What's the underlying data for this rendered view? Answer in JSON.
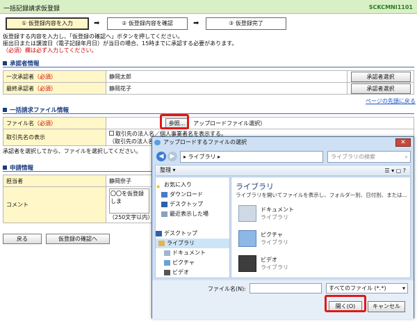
{
  "header": {
    "title": "一括記録請求仮登録",
    "code": "SCKCMNI1101"
  },
  "steps": [
    "① 仮登録内容を入力",
    "② 仮登録内容を確認",
    "③ 仮登録完了"
  ],
  "arrow": "➡",
  "intro": [
    "仮登録する内容を入力し、「仮登録の確認へ」ボタンを押してください。",
    "振出日または譲渡日（電子記録年月日）が当日の場合、15時までに承認する必要があります。",
    "（必須）欄は必ず入力してください。"
  ],
  "approvers": {
    "heading": "承認者情報",
    "rows": [
      {
        "label": "一次承認者",
        "req": "（必須）",
        "value": "静岡太郎",
        "button": "承認者選択"
      },
      {
        "label": "最終承認者",
        "req": "（必須）",
        "value": "静岡花子",
        "button": "承認者選択"
      }
    ],
    "page_top": "ページの先頭に戻る"
  },
  "file": {
    "heading": "一括請求ファイル情報",
    "file_label": "ファイル名",
    "file_req": "（必須）",
    "browse": "参照...",
    "upload_text": "アップロードファイル選択）",
    "display_label": "取引先名の表示",
    "checkbox_text": "取引先の法人名／個人事業者名を表示する。",
    "check_note": "（取引先の法人名／",
    "note": "承認者を選択してから、ファイルを選択してください。"
  },
  "request": {
    "heading": "申請情報",
    "person_label": "担当者",
    "person_value": "静岡奈子",
    "comment_label": "コメント",
    "comment_value": "〇〇を仮登録しま",
    "comment_limit": "（250文字以内）"
  },
  "buttons": {
    "back": "戻る",
    "confirm": "仮登録の確認へ"
  },
  "dialog": {
    "title": "アップロードするファイルの選択",
    "address": "▸ ライブラリ ▸",
    "search_placeholder": "ライブラリの検索",
    "organize": "整理 ▾",
    "nav": {
      "favorites": "お気に入り",
      "downloads": "ダウンロード",
      "desktop_fav": "デスクトップ",
      "recent": "最近表示した場",
      "desktop": "デスクトップ",
      "library": "ライブラリ",
      "documents": "ドキュメント",
      "pictures": "ピクチャ",
      "video": "ビデオ"
    },
    "lib_title": "ライブラリ",
    "lib_desc": "ライブラリを開いてファイルを表示し、フォルダー別、日付別、または...",
    "items": [
      {
        "name": "ドキュメント",
        "sub": "ライブラリ"
      },
      {
        "name": "ピクチャ",
        "sub": "ライブラリ"
      },
      {
        "name": "ビデオ",
        "sub": "ライブラリ"
      }
    ],
    "filename_label": "ファイル名(N):",
    "filetype": "すべてのファイル (*.*)",
    "open": "開く(O)",
    "cancel": "キャンセル"
  }
}
